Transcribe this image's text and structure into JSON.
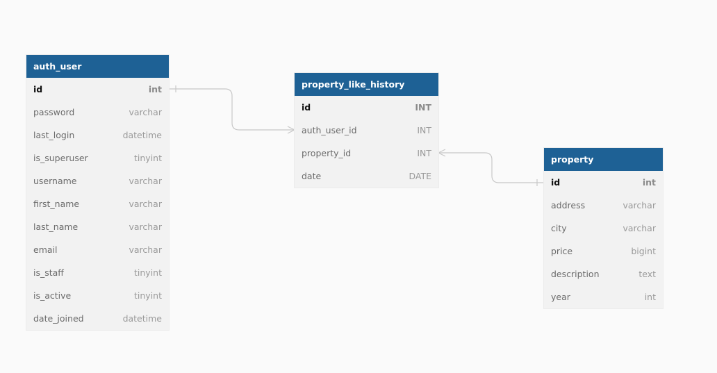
{
  "colors": {
    "canvas": "#fafafa",
    "table_header": "#1e6195",
    "table_body": "#f2f2f2",
    "relation_line": "#c8c8c8"
  },
  "tables": {
    "auth_user": {
      "name": "auth_user",
      "columns": [
        {
          "name": "id",
          "type": "int",
          "pk": true
        },
        {
          "name": "password",
          "type": "varchar"
        },
        {
          "name": "last_login",
          "type": "datetime"
        },
        {
          "name": "is_superuser",
          "type": "tinyint"
        },
        {
          "name": "username",
          "type": "varchar"
        },
        {
          "name": "first_name",
          "type": "varchar"
        },
        {
          "name": "last_name",
          "type": "varchar"
        },
        {
          "name": "email",
          "type": "varchar"
        },
        {
          "name": "is_staff",
          "type": "tinyint"
        },
        {
          "name": "is_active",
          "type": "tinyint"
        },
        {
          "name": "date_joined",
          "type": "datetime"
        }
      ]
    },
    "property_like_history": {
      "name": "property_like_history",
      "columns": [
        {
          "name": "id",
          "type": "INT",
          "pk": true
        },
        {
          "name": "auth_user_id",
          "type": "INT"
        },
        {
          "name": "property_id",
          "type": "INT"
        },
        {
          "name": "date",
          "type": "DATE"
        }
      ]
    },
    "property": {
      "name": "property",
      "columns": [
        {
          "name": "id",
          "type": "int",
          "pk": true
        },
        {
          "name": "address",
          "type": "varchar"
        },
        {
          "name": "city",
          "type": "varchar"
        },
        {
          "name": "price",
          "type": "bigint"
        },
        {
          "name": "description",
          "type": "text"
        },
        {
          "name": "year",
          "type": "int"
        }
      ]
    }
  },
  "relations": [
    {
      "from": "auth_user.id",
      "to": "property_like_history.auth_user_id",
      "from_cardinality": "one",
      "to_cardinality": "many"
    },
    {
      "from": "property_like_history.property_id",
      "to": "property.id",
      "from_cardinality": "many",
      "to_cardinality": "one"
    }
  ]
}
